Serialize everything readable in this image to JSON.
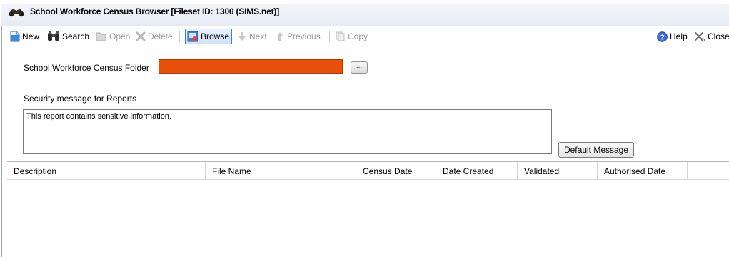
{
  "window": {
    "title": "School Workforce Census Browser [Fileset ID: 1300 (SIMS.net)]",
    "icon": "binoculars-icon"
  },
  "toolbar": {
    "new": "New",
    "search": "Search",
    "open": "Open",
    "delete": "Delete",
    "browse": "Browse",
    "next": "Next",
    "previous": "Previous",
    "copy": "Copy",
    "help": "Help",
    "close": "Close"
  },
  "form": {
    "folder_label": "School Workforce Census Folder",
    "folder_value": "",
    "folder_field_color": "#e8500a",
    "browse_button": "...",
    "security_label": "Security message for Reports",
    "security_message": "This report contains sensitive information.",
    "default_message_button": "Default Message"
  },
  "grid": {
    "columns": [
      "Description",
      "File Name",
      "Census Date",
      "Date Created",
      "Validated",
      "Authorised Date"
    ],
    "rows": []
  }
}
